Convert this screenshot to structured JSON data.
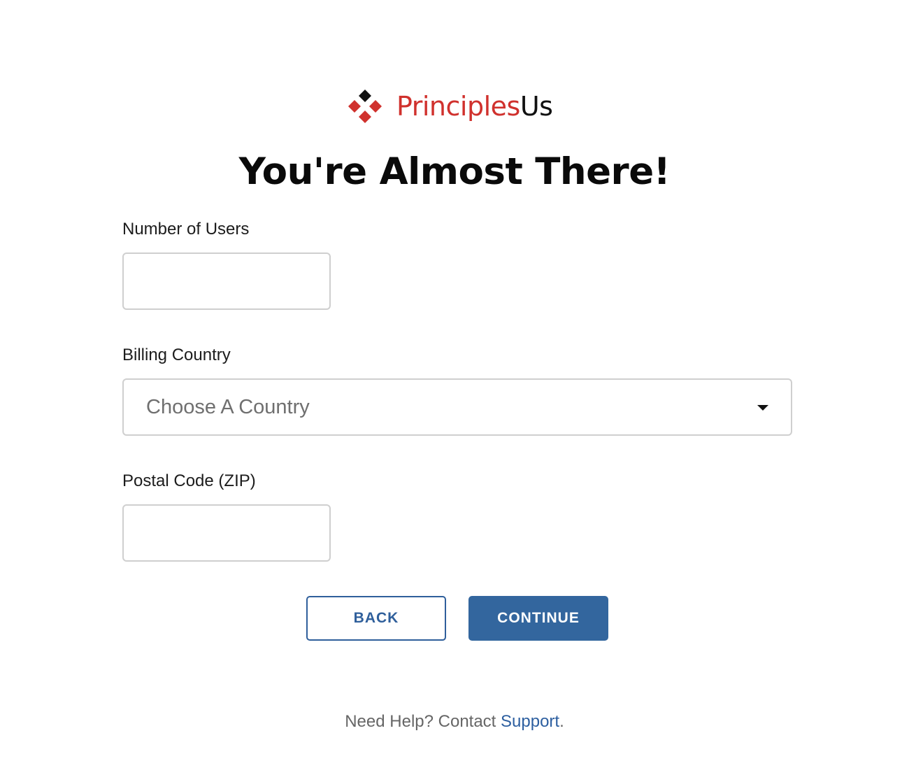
{
  "brand": {
    "name_part1": "Principles",
    "name_part2": "Us",
    "colors": {
      "red": "#d0312d",
      "dark": "#111111"
    }
  },
  "title": "You're Almost There!",
  "form": {
    "users": {
      "label": "Number of Users",
      "value": ""
    },
    "country": {
      "label": "Billing Country",
      "placeholder": "Choose A Country"
    },
    "postal": {
      "label": "Postal Code (ZIP)",
      "value": ""
    }
  },
  "buttons": {
    "back": "BACK",
    "continue": "CONTINUE"
  },
  "help": {
    "prefix": "Need Help? Contact",
    "link": "Support",
    "suffix": "."
  },
  "colors": {
    "accent": "#33669e",
    "input_border": "#cfcfcf"
  },
  "icons": {
    "logo": "diamond-cluster-icon",
    "dropdown": "caret-down-icon"
  }
}
